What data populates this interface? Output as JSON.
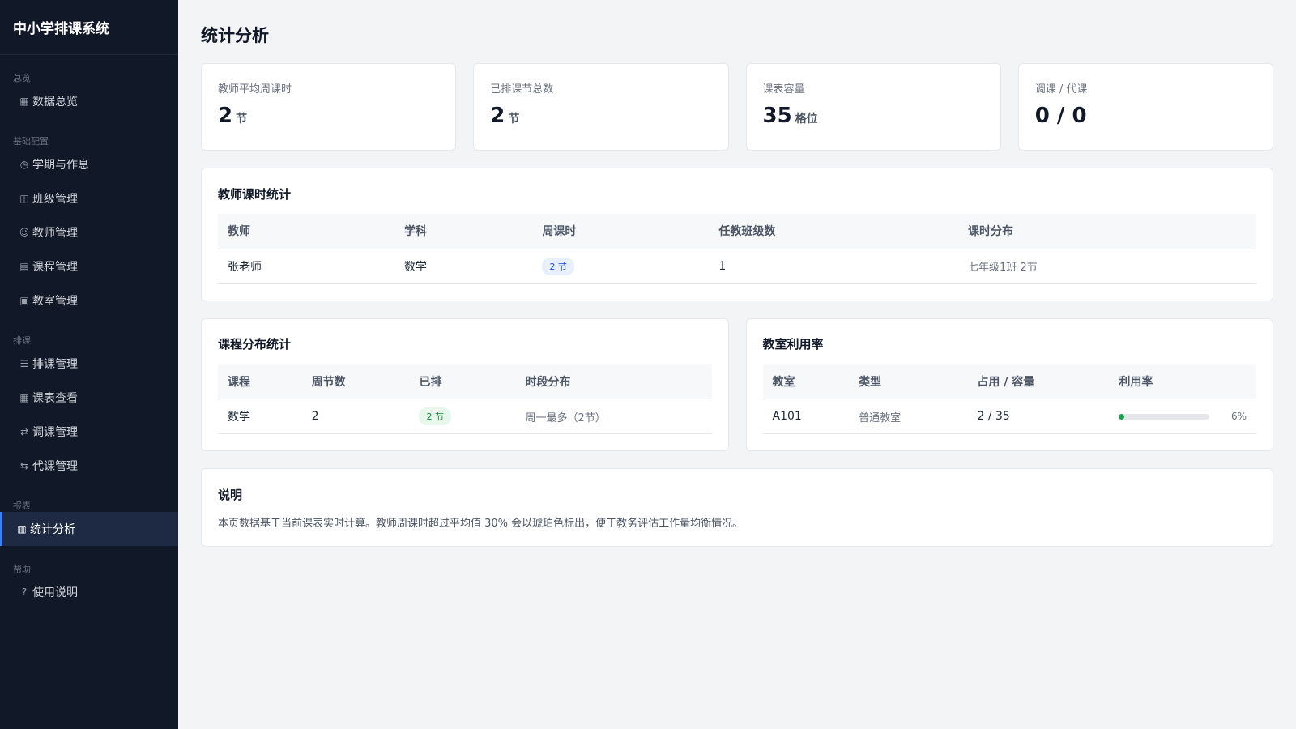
{
  "app": {
    "title": "中小学排课系统"
  },
  "sidebar": {
    "sections": [
      {
        "label": "总览",
        "items": [
          {
            "icon": "▦",
            "icon_name": "grid-icon",
            "label": "数据总览"
          }
        ]
      },
      {
        "label": "基础配置",
        "items": [
          {
            "icon": "◷",
            "icon_name": "clock-icon",
            "label": "学期与作息"
          },
          {
            "icon": "◫",
            "icon_name": "class-icon",
            "label": "班级管理"
          },
          {
            "icon": "☺",
            "icon_name": "teacher-icon",
            "label": "教师管理"
          },
          {
            "icon": "▤",
            "icon_name": "course-icon",
            "label": "课程管理"
          },
          {
            "icon": "▣",
            "icon_name": "classroom-icon",
            "label": "教室管理"
          }
        ]
      },
      {
        "label": "排课",
        "items": [
          {
            "icon": "☰",
            "icon_name": "schedule-icon",
            "label": "排课管理"
          },
          {
            "icon": "▦",
            "icon_name": "timetable-icon",
            "label": "课表查看"
          },
          {
            "icon": "⇄",
            "icon_name": "swap-icon",
            "label": "调课管理"
          },
          {
            "icon": "⇆",
            "icon_name": "substitute-icon",
            "label": "代课管理"
          }
        ]
      },
      {
        "label": "报表",
        "items": [
          {
            "icon": "▥",
            "icon_name": "chart-icon",
            "label": "统计分析",
            "active": true
          }
        ]
      },
      {
        "label": "帮助",
        "items": [
          {
            "icon": "?",
            "icon_name": "help-icon",
            "label": "使用说明"
          }
        ]
      }
    ]
  },
  "page": {
    "title": "统计分析"
  },
  "stats": [
    {
      "label": "教师平均周课时",
      "value": "2",
      "unit": "节"
    },
    {
      "label": "已排课节总数",
      "value": "2",
      "unit": "节"
    },
    {
      "label": "课表容量",
      "value": "35",
      "unit": "格位"
    },
    {
      "label": "调课 / 代课",
      "value": "0 / 0",
      "unit": ""
    }
  ],
  "teacher_stats": {
    "title": "教师课时统计",
    "headers": [
      "教师",
      "学科",
      "周课时",
      "任教班级数",
      "课时分布"
    ],
    "rows": [
      {
        "teacher": "张老师",
        "subject": "数学",
        "hours": "2 节",
        "classes": "1",
        "distribution": "七年级1班 2节"
      }
    ]
  },
  "course_stats": {
    "title": "课程分布统计",
    "headers": [
      "课程",
      "周节数",
      "已排",
      "时段分布"
    ],
    "rows": [
      {
        "course": "数学",
        "weekly": "2",
        "scheduled": "2 节",
        "period": "周一最多（2节）"
      }
    ]
  },
  "room_stats": {
    "title": "教室利用率",
    "headers": [
      "教室",
      "类型",
      "占用 / 容量",
      "利用率"
    ],
    "rows": [
      {
        "room": "A101",
        "type": "普通教室",
        "usage": "2 / 35",
        "rate": 0.06,
        "rate_label": "6%"
      }
    ]
  },
  "note": {
    "title": "说明",
    "text": "本页数据基于当前课表实时计算。教师周课时超过平均值 30% 会以琥珀色标出，便于教务评估工作量均衡情况。"
  },
  "colors": {
    "accent": "#3b82f6",
    "sidebar_bg": "#111827",
    "success": "#16a34a"
  }
}
